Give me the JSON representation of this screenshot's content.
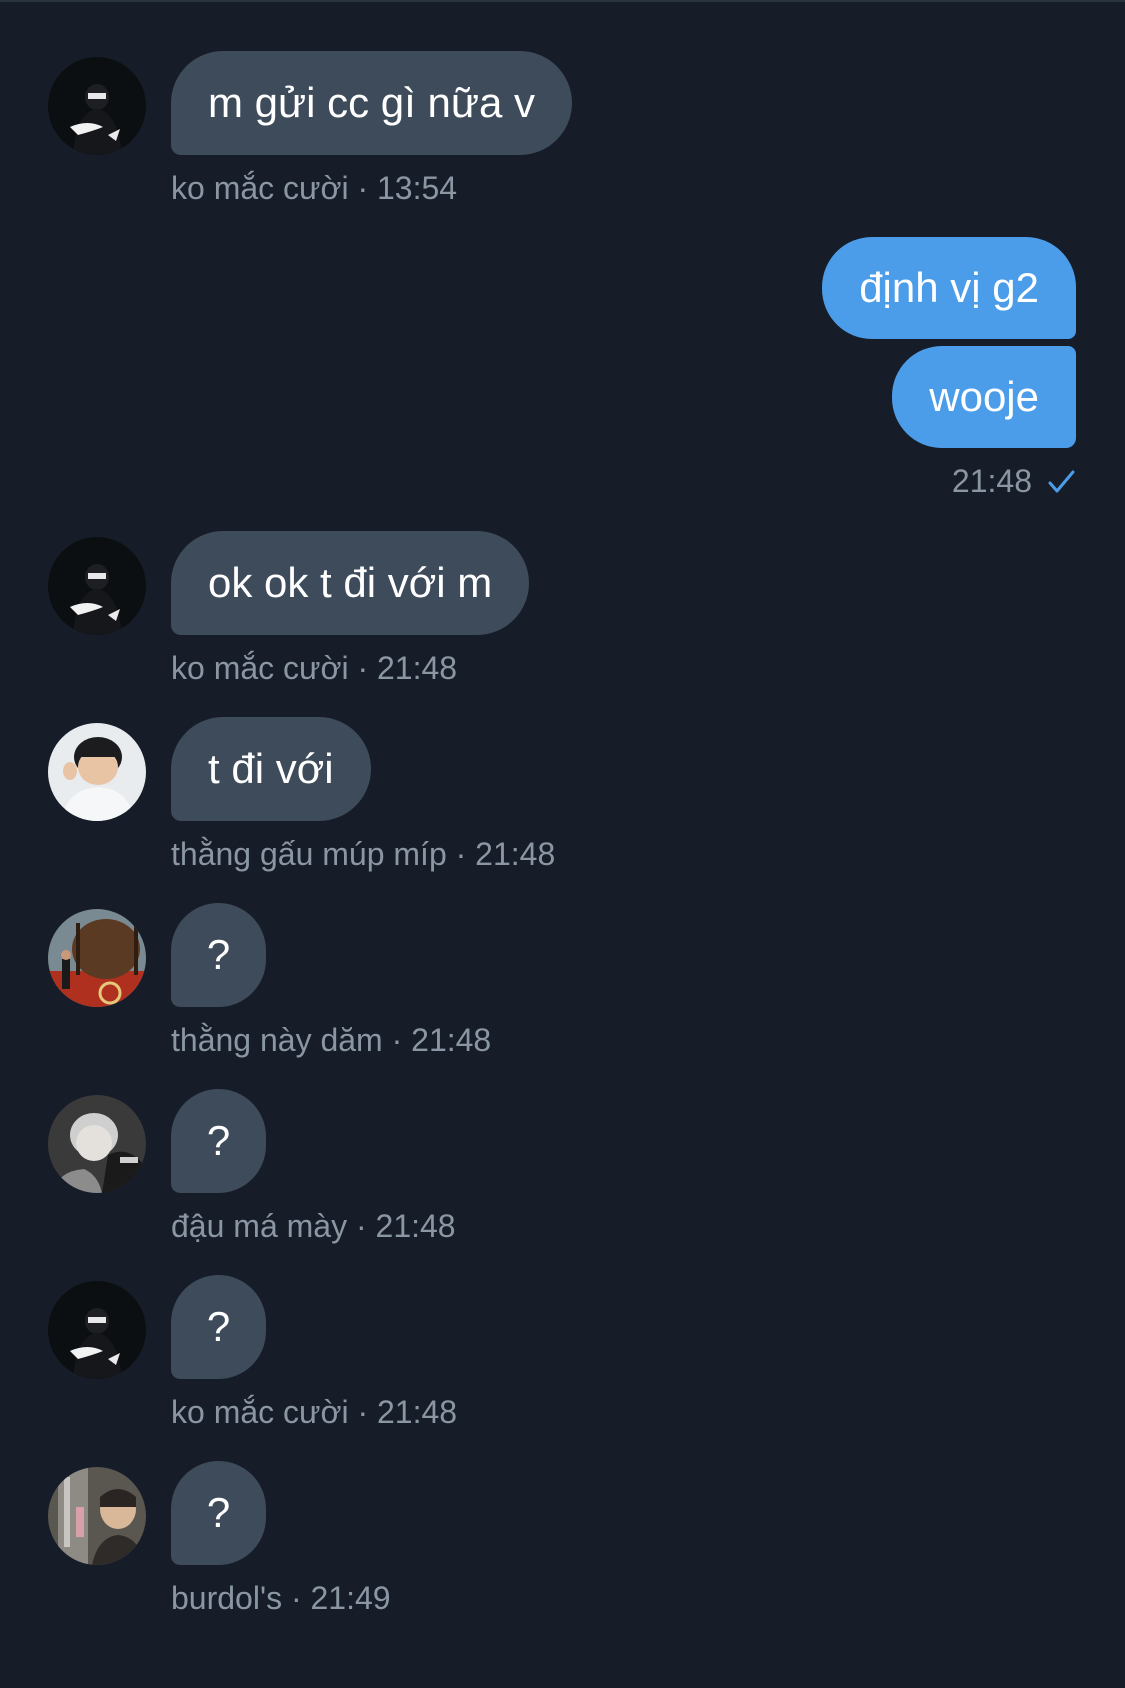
{
  "messages": [
    {
      "id": "m1",
      "direction": "in",
      "avatar": "dark-night-avatar",
      "text": "m gửi cc gì nữa v",
      "sender": "ko mắc cười",
      "time": "13:54"
    },
    {
      "id": "m2",
      "direction": "out",
      "text": "định vị g2"
    },
    {
      "id": "m3",
      "direction": "out",
      "text": "wooje",
      "time": "21:48",
      "status_icon": "check-icon"
    },
    {
      "id": "m4",
      "direction": "in",
      "avatar": "dark-night-avatar",
      "text": "ok ok t đi với m",
      "sender": "ko mắc cười",
      "time": "21:48"
    },
    {
      "id": "m5",
      "direction": "in",
      "avatar": "child-photo-avatar",
      "text": "t đi với",
      "sender": "thằng gấu múp míp",
      "time": "21:48"
    },
    {
      "id": "m6",
      "direction": "in",
      "avatar": "barrel-photo-avatar",
      "text": "?",
      "sender": "thằng này dăm",
      "time": "21:48"
    },
    {
      "id": "m7",
      "direction": "in",
      "avatar": "grey-portrait-avatar",
      "text": "?",
      "sender": "đậu má mày ",
      "time": "21:48"
    },
    {
      "id": "m8",
      "direction": "in",
      "avatar": "dark-night-avatar",
      "text": "?",
      "sender": "ko mắc cười",
      "time": "21:48"
    },
    {
      "id": "m9",
      "direction": "in",
      "avatar": "mirror-selfie-avatar",
      "text": "?",
      "sender": "burdol's",
      "time": "21:49"
    }
  ],
  "separator": " · ",
  "colors": {
    "background": "#161d28",
    "incoming_bubble": "#3d4b5b",
    "outgoing_bubble": "#4c9de9",
    "meta_text": "#8b96a4",
    "check": "#4c9de9"
  }
}
